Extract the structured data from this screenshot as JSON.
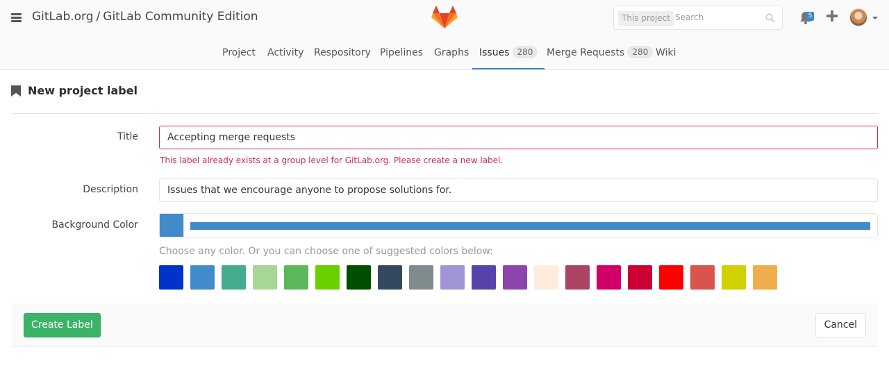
{
  "header": {
    "group": "GitLab.org",
    "separator": "/",
    "project": "GitLab Community Edition",
    "search_scope": "This project",
    "search_placeholder": "Search",
    "notification_count": "5"
  },
  "nav": {
    "items": [
      {
        "label": "Project"
      },
      {
        "label": "Activity"
      },
      {
        "label": "Respository"
      },
      {
        "label": "Pipelines"
      },
      {
        "label": "Graphs"
      },
      {
        "label": "Issues",
        "count": "280"
      },
      {
        "label": "Merge Requests",
        "count": "280"
      },
      {
        "label": "Wiki"
      }
    ],
    "active": "Issues"
  },
  "page": {
    "heading": "New project label"
  },
  "form": {
    "title_label": "Title",
    "title_value": "Accepting merge requests",
    "title_error": "This label already exists at a group level for GitLab.org. Please create a new label.",
    "description_label": "Description",
    "description_value": "Issues that we encourage anyone to propose solutions for.",
    "color_label": "Background Color",
    "color_value": "#428BCA",
    "color_hint": "Choose any color. Or you can choose one of suggested colors below:",
    "suggested_colors": [
      "#0033CC",
      "#428BCA",
      "#44AD8E",
      "#A8D695",
      "#5CB85C",
      "#69D100",
      "#004E00",
      "#34495E",
      "#7F8C8D",
      "#A295D6",
      "#5843AD",
      "#8E44AD",
      "#FFECDB",
      "#AD4363",
      "#D10069",
      "#CC0033",
      "#FF0000",
      "#D9534F",
      "#D1D100",
      "#F0AD4E",
      "#AD8D43"
    ]
  },
  "actions": {
    "create_label": "Create Label",
    "cancel_label": "Cancel"
  },
  "colors": {
    "accent": "#3f87ce",
    "error": "#d22852",
    "create_button": "#3cb467"
  }
}
